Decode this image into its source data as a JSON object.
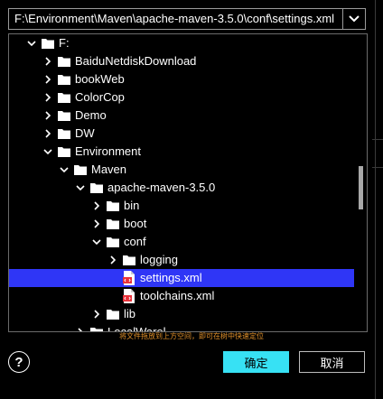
{
  "path_bar": {
    "value": "F:\\Environment\\Maven\\apache-maven-3.5.0\\conf\\settings.xml"
  },
  "tree": [
    {
      "label": "F:",
      "level": 0,
      "type": "drive",
      "expanded": true
    },
    {
      "label": "BaiduNetdiskDownload",
      "level": 1,
      "type": "folder",
      "expanded": false
    },
    {
      "label": "bookWeb",
      "level": 1,
      "type": "folder",
      "expanded": false
    },
    {
      "label": "ColorCop",
      "level": 1,
      "type": "folder",
      "expanded": false
    },
    {
      "label": "Demo",
      "level": 1,
      "type": "folder",
      "expanded": false
    },
    {
      "label": "DW",
      "level": 1,
      "type": "folder",
      "expanded": false
    },
    {
      "label": "Environment",
      "level": 1,
      "type": "folder",
      "expanded": true
    },
    {
      "label": "Maven",
      "level": 2,
      "type": "folder",
      "expanded": true
    },
    {
      "label": "apache-maven-3.5.0",
      "level": 3,
      "type": "folder",
      "expanded": true
    },
    {
      "label": "bin",
      "level": 4,
      "type": "folder",
      "expanded": false
    },
    {
      "label": "boot",
      "level": 4,
      "type": "folder",
      "expanded": false
    },
    {
      "label": "conf",
      "level": 4,
      "type": "folder",
      "expanded": true
    },
    {
      "label": "logging",
      "level": 5,
      "type": "folder",
      "expanded": false
    },
    {
      "label": "settings.xml",
      "level": 5,
      "type": "file",
      "selected": true
    },
    {
      "label": "toolchains.xml",
      "level": 5,
      "type": "file"
    },
    {
      "label": "lib",
      "level": 4,
      "type": "folder",
      "expanded": false
    },
    {
      "label": "LocalWarel",
      "level": 3,
      "type": "folder",
      "expanded": false
    }
  ],
  "hint": "将文件拖放到上方空间，即可在树中快速定位",
  "buttons": {
    "help": "?",
    "ok": "确定",
    "cancel": "取消"
  },
  "icons": {
    "dropdown": "chevron-down-icon",
    "expand": "chevron-right-icon",
    "collapse": "chevron-down-icon",
    "folder": "folder-icon",
    "file": "xml-file-icon"
  },
  "colors": {
    "selection": "#2f36f6",
    "ok_button": "#37e1f4",
    "hint_text": "#e0902a",
    "xml_icon": "#e8313a"
  }
}
